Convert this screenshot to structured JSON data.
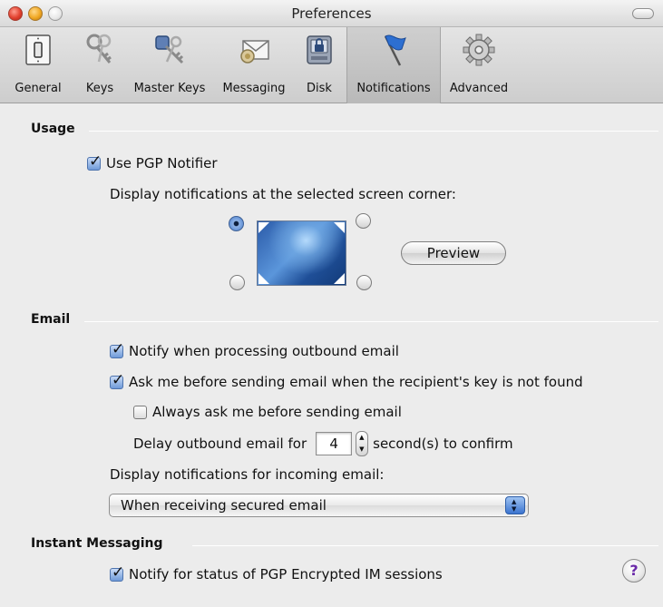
{
  "window": {
    "title": "Preferences"
  },
  "toolbar": {
    "items": [
      {
        "label": "General",
        "icon": "light-switch-icon"
      },
      {
        "label": "Keys",
        "icon": "keys-icon"
      },
      {
        "label": "Master Keys",
        "icon": "master-keys-icon"
      },
      {
        "label": "Messaging",
        "icon": "messaging-envelope-icon"
      },
      {
        "label": "Disk",
        "icon": "disk-lock-icon"
      },
      {
        "label": "Notifications",
        "icon": "flag-icon"
      },
      {
        "label": "Advanced",
        "icon": "gear-icon"
      }
    ],
    "selected": "Notifications"
  },
  "usage": {
    "title": "Usage",
    "use_notifier": {
      "label": "Use PGP Notifier",
      "checked": true
    },
    "corner_prompt": "Display notifications at the selected screen corner:",
    "selected_corner": "top-left",
    "preview_label": "Preview"
  },
  "email": {
    "title": "Email",
    "notify_outbound": {
      "label": "Notify when processing outbound email",
      "checked": true
    },
    "ask_key_not_found": {
      "label": "Ask me before sending email when the recipient's key is not found",
      "checked": true
    },
    "always_ask": {
      "label": "Always ask me before sending email",
      "checked": false
    },
    "delay_prefix": "Delay outbound email for",
    "delay_value": "4",
    "delay_suffix": "second(s) to confirm",
    "incoming_prompt": "Display notifications for incoming email:",
    "incoming_selected": "When receiving secured email"
  },
  "im": {
    "title": "Instant Messaging",
    "notify_im": {
      "label": "Notify for status of PGP Encrypted IM sessions",
      "checked": true
    },
    "help_label": "?"
  },
  "colors": {
    "accent": "#3b74cf",
    "window_bg": "#ececec",
    "help_glyph": "#6a2aa8"
  }
}
